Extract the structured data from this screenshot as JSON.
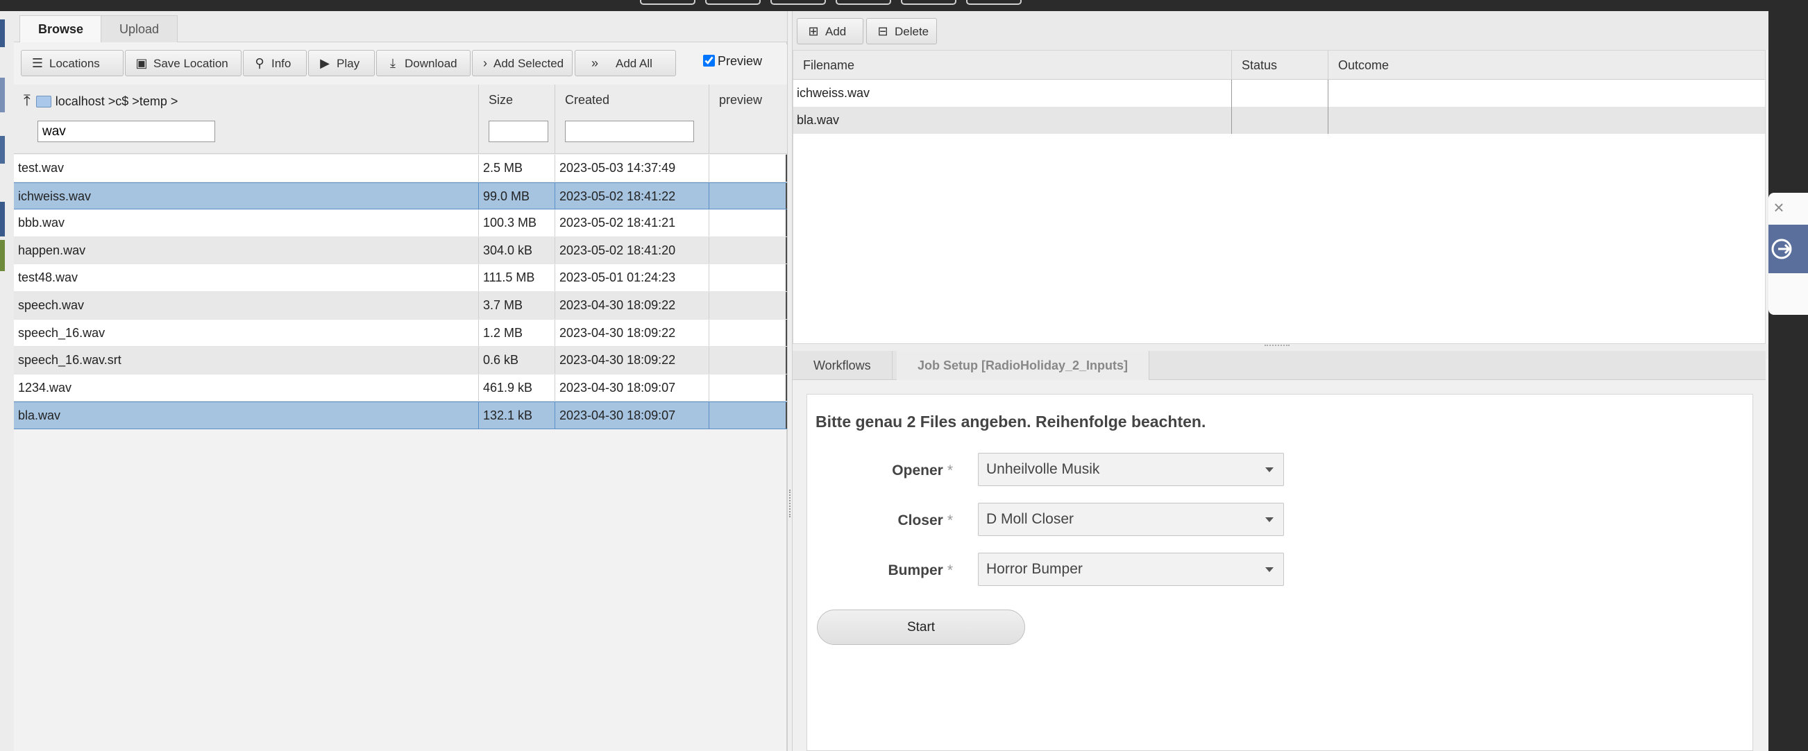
{
  "left": {
    "tabs": [
      "Browse",
      "Upload"
    ],
    "toolbar": {
      "locations": "Locations",
      "save_location": "Save Location",
      "info": "Info",
      "play": "Play",
      "download": "Download",
      "add_selected": "Add Selected",
      "add_all": "Add All",
      "preview": "Preview"
    },
    "path": "localhost >c$ >temp >",
    "columns": {
      "size": "Size",
      "created": "Created",
      "preview": "preview"
    },
    "filter": {
      "name": "wav",
      "size": "",
      "created": ""
    },
    "files": [
      {
        "name": "test.wav",
        "size": "2.5 MB",
        "created": "2023-05-03 14:37:49",
        "selected": false
      },
      {
        "name": "ichweiss.wav",
        "size": "99.0 MB",
        "created": "2023-05-02 18:41:22",
        "selected": true
      },
      {
        "name": "bbb.wav",
        "size": "100.3 MB",
        "created": "2023-05-02 18:41:21",
        "selected": false
      },
      {
        "name": "happen.wav",
        "size": "304.0 kB",
        "created": "2023-05-02 18:41:20",
        "selected": false
      },
      {
        "name": "test48.wav",
        "size": "111.5 MB",
        "created": "2023-05-01 01:24:23",
        "selected": false
      },
      {
        "name": "speech.wav",
        "size": "3.7 MB",
        "created": "2023-04-30 18:09:22",
        "selected": false
      },
      {
        "name": "speech_16.wav",
        "size": "1.2 MB",
        "created": "2023-04-30 18:09:22",
        "selected": false
      },
      {
        "name": "speech_16.wav.srt",
        "size": "0.6 kB",
        "created": "2023-04-30 18:09:22",
        "selected": false
      },
      {
        "name": "1234.wav",
        "size": "461.9 kB",
        "created": "2023-04-30 18:09:07",
        "selected": false
      },
      {
        "name": "bla.wav",
        "size": "132.1 kB",
        "created": "2023-04-30 18:09:07",
        "selected": true
      }
    ]
  },
  "right": {
    "toolbar": {
      "add": "Add",
      "delete": "Delete"
    },
    "queue_columns": {
      "filename": "Filename",
      "status": "Status",
      "outcome": "Outcome"
    },
    "queue": [
      {
        "filename": "ichweiss.wav",
        "status": "",
        "outcome": ""
      },
      {
        "filename": "bla.wav",
        "status": "",
        "outcome": ""
      }
    ],
    "tabs": [
      "Workflows",
      "Job Setup [RadioHoliday_2_Inputs]"
    ],
    "form": {
      "title": "Bitte genau 2 Files angeben. Reihenfolge beachten.",
      "fields": [
        {
          "label": "Opener",
          "value": "Unheilvolle Musik"
        },
        {
          "label": "Closer",
          "value": "D Moll Closer"
        },
        {
          "label": "Bumper",
          "value": "Horror Bumper"
        }
      ],
      "required_mark": "*",
      "start": "Start"
    }
  },
  "colors": {
    "selected_row": "#a6c4e0",
    "accent_blue": "#5a6f9c"
  }
}
